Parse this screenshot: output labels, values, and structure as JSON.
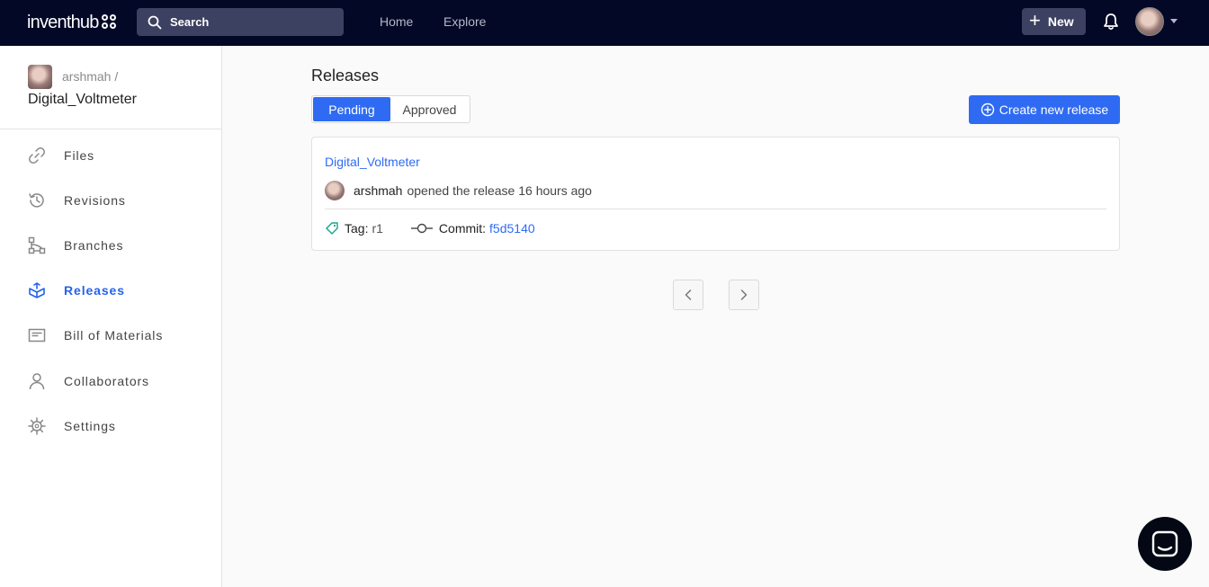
{
  "header": {
    "logo": "inventhub",
    "search_placeholder": "Search",
    "nav": [
      {
        "label": "Home"
      },
      {
        "label": "Explore"
      }
    ],
    "new_label": "New"
  },
  "sidebar": {
    "owner": "arshmah /",
    "repo": "Digital_Voltmeter",
    "items": [
      {
        "label": "Files",
        "icon": "link-icon"
      },
      {
        "label": "Revisions",
        "icon": "history-icon"
      },
      {
        "label": "Branches",
        "icon": "branches-icon"
      },
      {
        "label": "Releases",
        "icon": "release-box-icon",
        "active": true
      },
      {
        "label": "Bill of Materials",
        "icon": "list-icon"
      },
      {
        "label": "Collaborators",
        "icon": "user-icon"
      },
      {
        "label": "Settings",
        "icon": "gear-icon"
      }
    ]
  },
  "main": {
    "title": "Releases",
    "tabs": [
      {
        "label": "Pending",
        "active": true
      },
      {
        "label": "Approved"
      }
    ],
    "create_label": "Create new release",
    "release": {
      "title": "Digital_Voltmeter",
      "user": "arshmah",
      "action": "opened the release 16 hours ago",
      "tag_label": "Tag:",
      "tag_value": "r1",
      "commit_label": "Commit:",
      "commit_value": "f5d5140"
    }
  },
  "colors": {
    "nav_bg": "#020826",
    "accent": "#2f6bf2"
  }
}
